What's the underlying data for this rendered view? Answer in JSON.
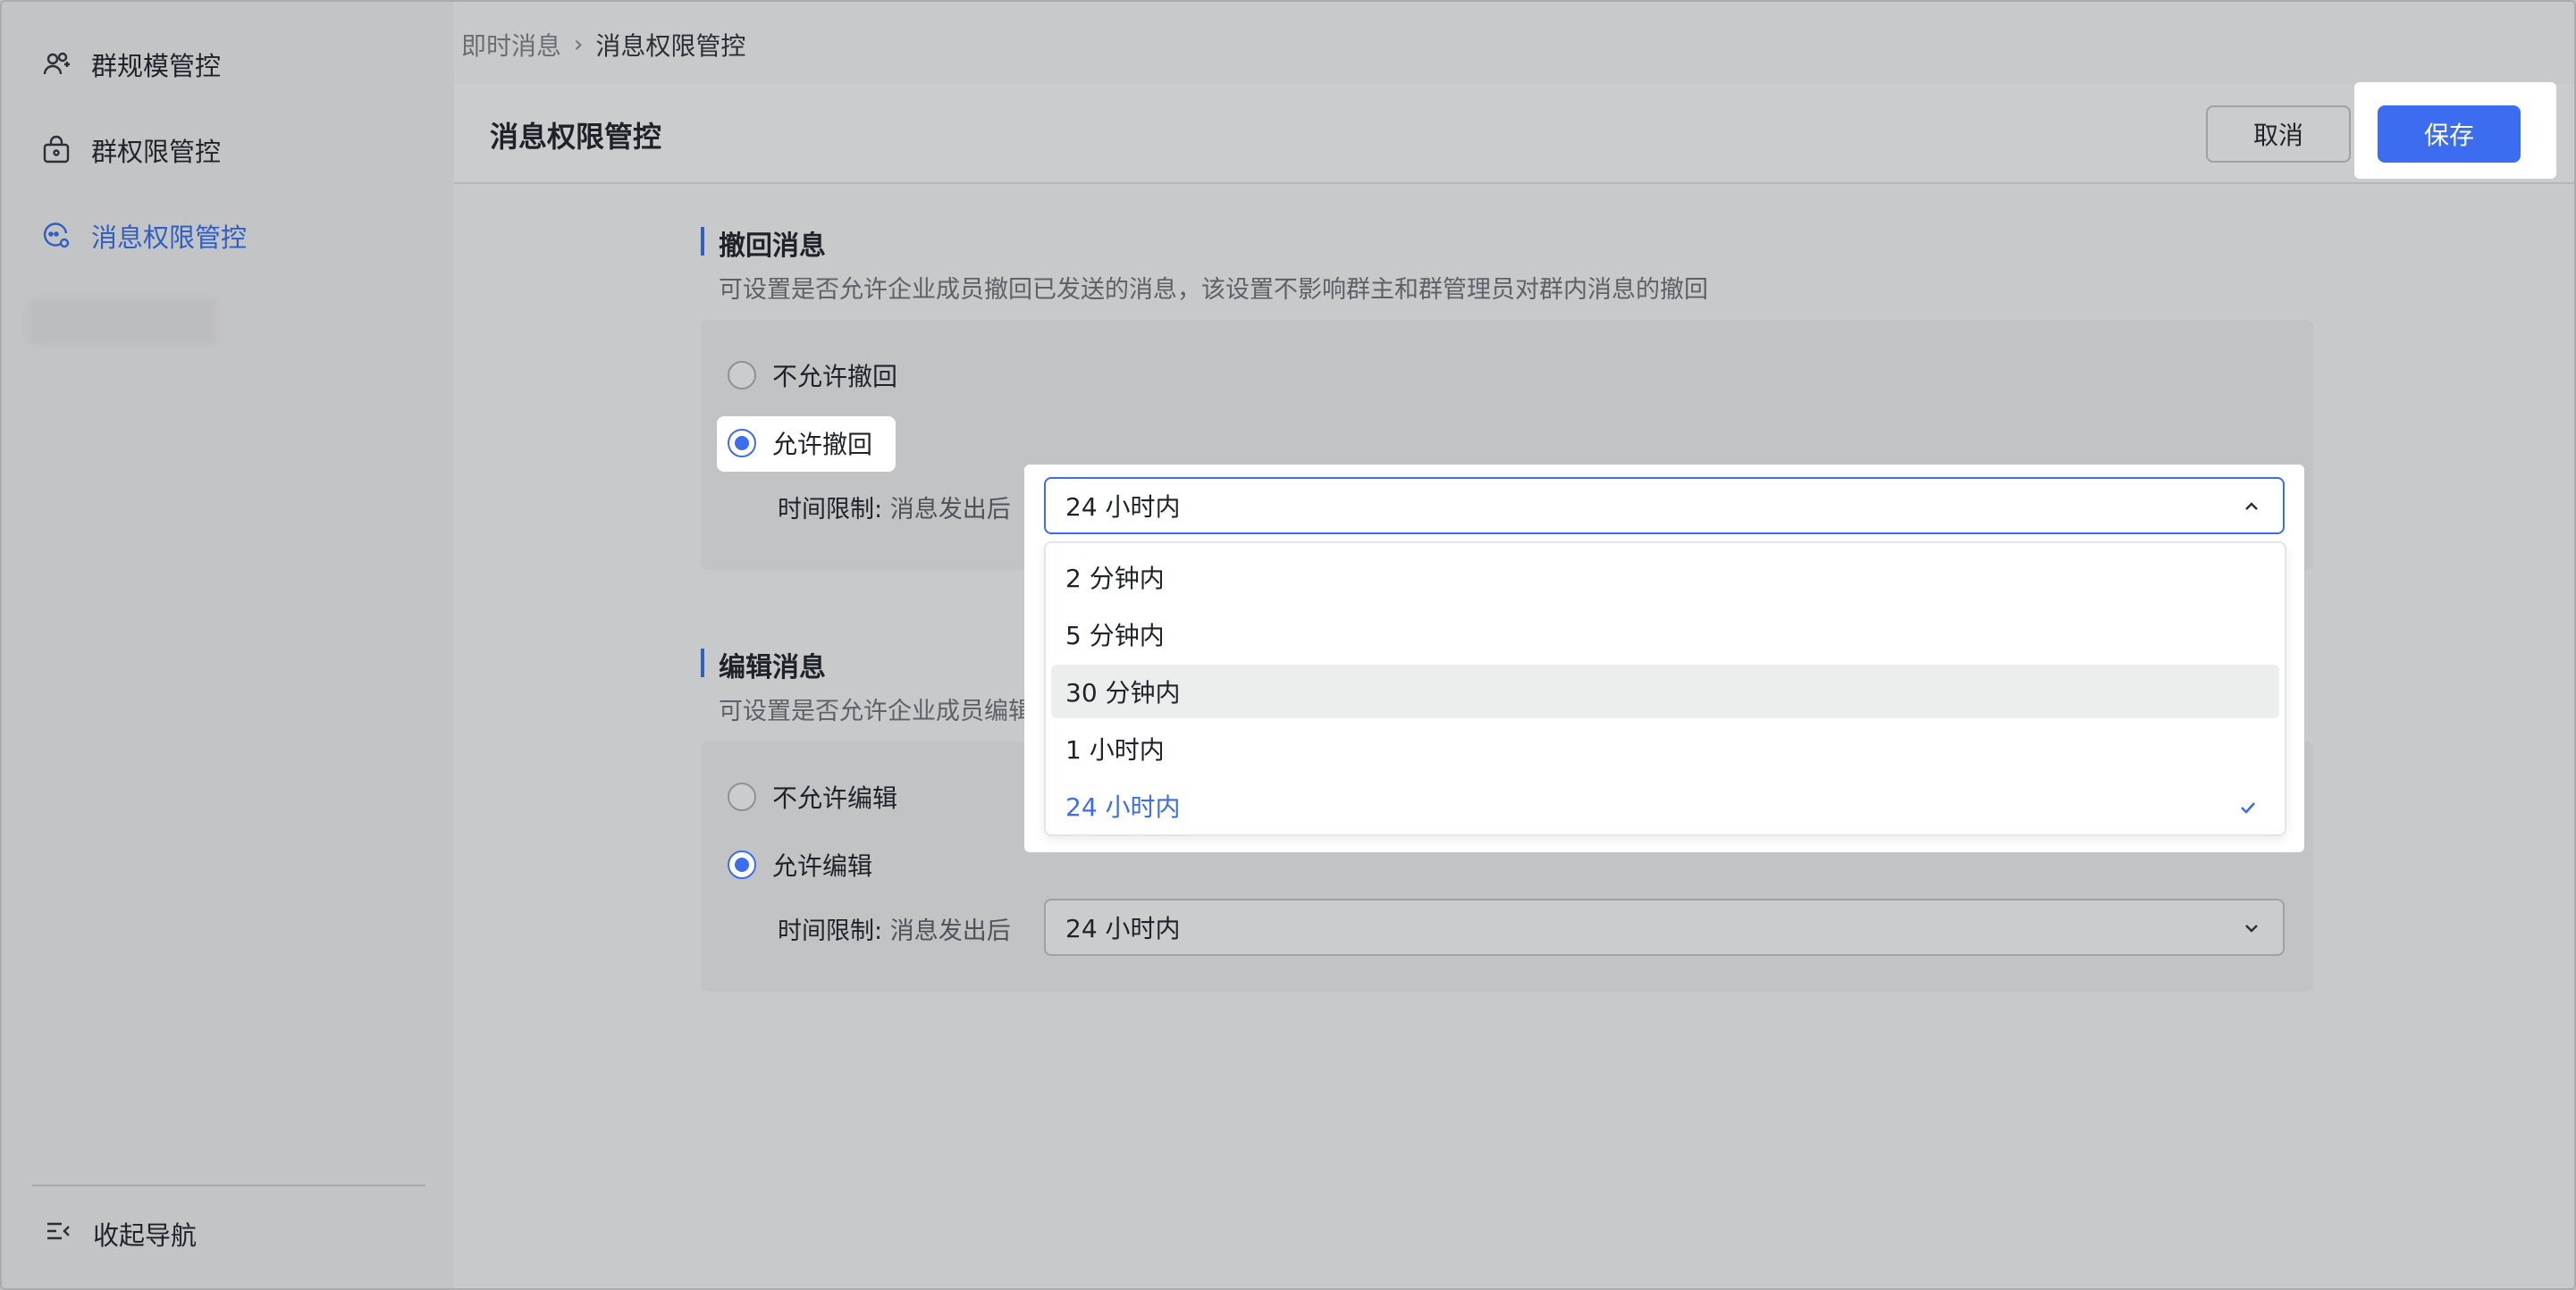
{
  "sidebar": {
    "items": [
      {
        "label": "群规模管控",
        "icon": "group-scale-icon",
        "active": false
      },
      {
        "label": "群权限管控",
        "icon": "lock-bag-icon",
        "active": false
      },
      {
        "label": "消息权限管控",
        "icon": "message-settings-icon",
        "active": true
      }
    ],
    "collapse_label": "收起导航"
  },
  "breadcrumb": {
    "parent": "即时消息",
    "current": "消息权限管控"
  },
  "header": {
    "title": "消息权限管控",
    "cancel_label": "取消",
    "save_label": "保存"
  },
  "recall": {
    "title": "撤回消息",
    "desc": "可设置是否允许企业成员撤回已发送的消息，该设置不影响群主和群管理员对群内消息的撤回",
    "option_deny": "不允许撤回",
    "option_allow": "允许撤回",
    "selected": "allow",
    "limit_label": "时间限制:",
    "limit_sub": "消息发出后",
    "limit_value": "24 小时内"
  },
  "edit": {
    "title": "编辑消息",
    "desc": "可设置是否允许企业成员编辑",
    "option_deny": "不允许编辑",
    "option_allow": "允许编辑",
    "selected": "allow",
    "limit_label": "时间限制:",
    "limit_sub": "消息发出后",
    "limit_value": "24 小时内"
  },
  "dropdown": {
    "value": "24 小时内",
    "options": [
      "2 分钟内",
      "5 分钟内",
      "30 分钟内",
      "1 小时内",
      "24 小时内"
    ],
    "hovered": "30 分钟内",
    "selected": "24 小时内"
  },
  "colors": {
    "accent": "#3c6cf0",
    "text": "#1f2329",
    "muted": "#5e6167"
  }
}
